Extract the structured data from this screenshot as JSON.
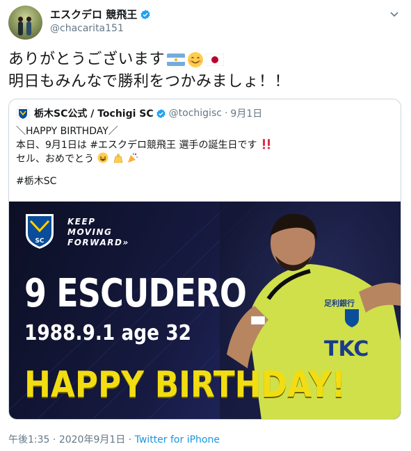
{
  "author": {
    "display_name": "エスクデロ 競飛王",
    "handle": "@chacarita151"
  },
  "tweet": {
    "line1": "ありがとうございます",
    "line2": "明日もみんなで勝利をつかみましょ！！"
  },
  "quoted": {
    "display_name": "栃木SC公式 / Tochigi SC",
    "handle": "@tochigisc",
    "separator": "·",
    "date": "9月1日",
    "line1": "＼HAPPY BIRTHDAY／",
    "line2_prefix": "本日、9月1日は",
    "line2_hashtag": "#エスクデロ競飛王",
    "line2_suffix": "選手の誕生日です",
    "line3": "セル、おめでとう",
    "hashtag": "#栃木SC"
  },
  "banner": {
    "keep": "KEEP",
    "moving": "MOVING",
    "forward": "FORWARD»",
    "player_name": "9 ESCUDERO",
    "dob_age": "1988.9.1  age 32",
    "greeting": "HAPPY BIRTHDAY!",
    "crest_text": "SC",
    "shirt_sponsor": "TKC",
    "shirt_chest": "足利銀行"
  },
  "footer": {
    "time": "午後1:35",
    "date": "2020年9月1日",
    "separator": "·",
    "source": "Twitter for iPhone"
  },
  "colors": {
    "verified": "#1da1f2",
    "link": "#1b95e0",
    "happy_yellow": "#f2dd12",
    "banner_navy": "#161a40"
  }
}
